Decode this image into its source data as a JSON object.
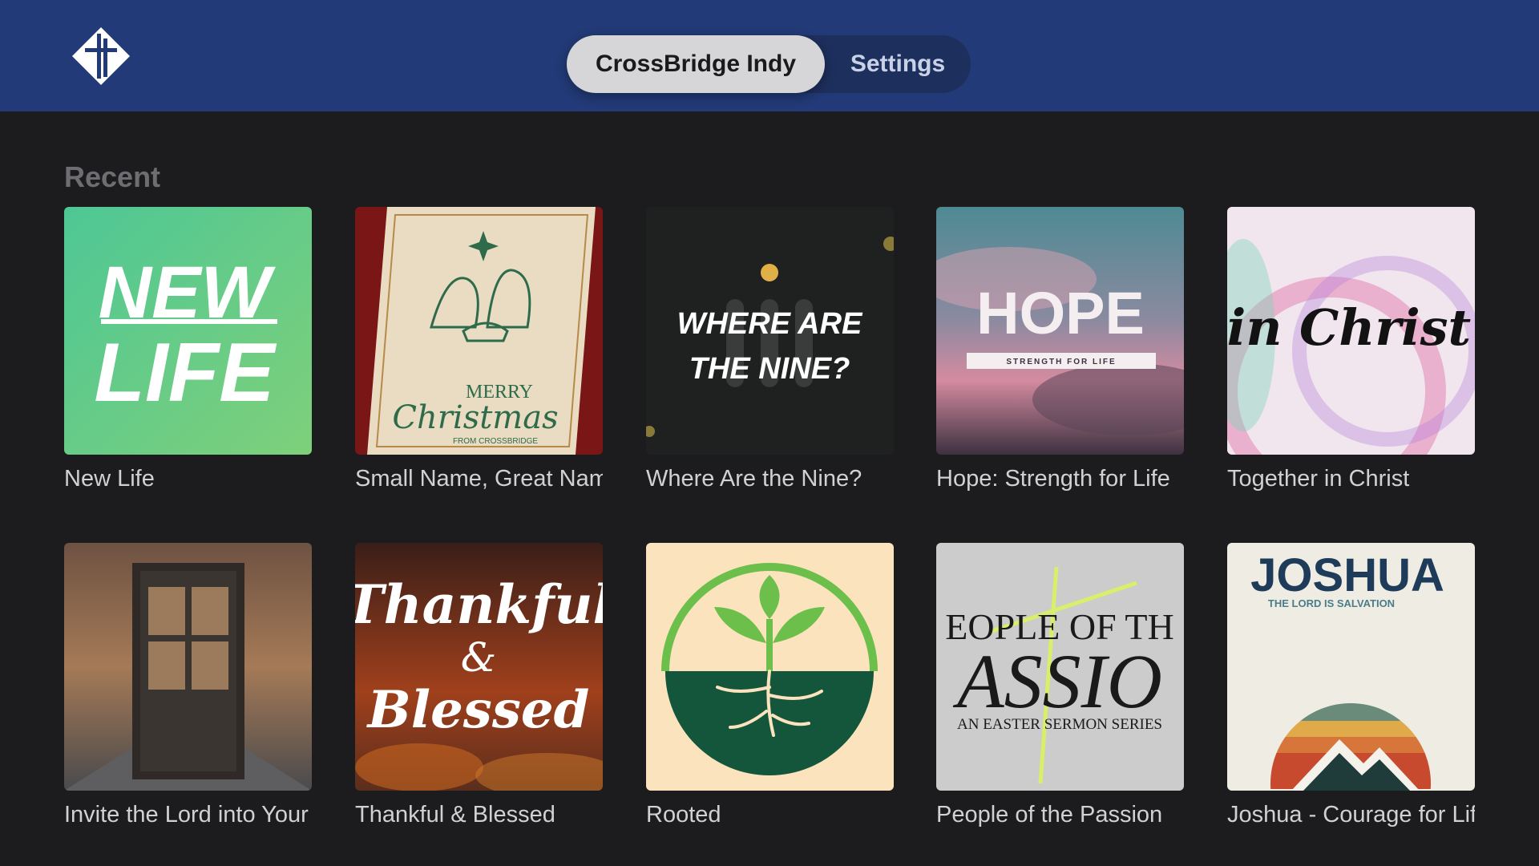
{
  "header": {
    "logo_icon": "crossbridge-cross-logo-icon",
    "tabs": [
      {
        "label": "CrossBridge Indy",
        "selected": true
      },
      {
        "label": "Settings",
        "selected": false
      }
    ]
  },
  "main": {
    "section_title": "Recent",
    "items": [
      {
        "title": "New Life",
        "art_text": [
          "NEW",
          "LIFE"
        ]
      },
      {
        "title": "Small Name, Great Name",
        "art_text": [
          "MERRY",
          "Christmas",
          "FROM CROSSBRIDGE"
        ]
      },
      {
        "title": "Where Are the Nine?",
        "art_text": [
          "WHERE ARE",
          "THE NINE?"
        ]
      },
      {
        "title": "Hope: Strength for Life",
        "art_text": [
          "HOPE",
          "STRENGTH FOR LIFE"
        ]
      },
      {
        "title": "Together in Christ",
        "art_text": [
          "in Christ"
        ]
      },
      {
        "title": "Invite the Lord into Your Home",
        "art_text": []
      },
      {
        "title": "Thankful & Blessed",
        "art_text": [
          "Thankful",
          "&",
          "Blessed"
        ]
      },
      {
        "title": "Rooted",
        "art_text": []
      },
      {
        "title": "People of the Passion",
        "art_text": [
          "EOPLE OF TH",
          "ASSIO",
          "AN EASTER SERMON SERIES"
        ]
      },
      {
        "title": "Joshua - Courage for Life",
        "art_text": [
          "JOSHUA",
          "THE LORD IS SALVATION"
        ]
      }
    ]
  },
  "colors": {
    "header_bg": "#223a77",
    "page_bg": "#1c1c1e",
    "selected_tab_bg": "#d6d6d8"
  }
}
